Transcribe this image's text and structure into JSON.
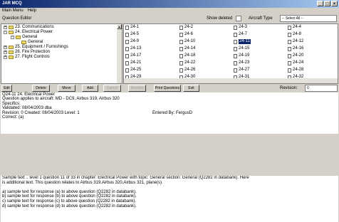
{
  "window": {
    "title": "JAR MCQ",
    "controls": [
      "_",
      "□",
      "×"
    ]
  },
  "menu": [
    "Main Menu",
    "Help"
  ],
  "toolbar": {
    "question_editor_label": "Question Editor",
    "show_deleted_label": "Show deleted",
    "aircraft_type_label": "Aircraft Type",
    "aircraft_type_value": "-- Select All --"
  },
  "tree": [
    {
      "expander": "+",
      "label": "23. Communications"
    },
    {
      "expander": "-",
      "label": "24. Electrical Power"
    },
    {
      "expander": "-",
      "label": "General"
    },
    {
      "expander": "",
      "label": "General"
    },
    {
      "expander": "+",
      "label": "25. Equipment / Furnishings"
    },
    {
      "expander": "+",
      "label": "26. Fire Protection"
    },
    {
      "expander": "+",
      "label": "27. Flight Controls"
    }
  ],
  "questions": [
    [
      "24-1",
      "24-2",
      "24-3",
      "24-4"
    ],
    [
      "24-5",
      "24-6",
      "24-7",
      "24-8"
    ],
    [
      "24-9",
      "24-10",
      "24-11",
      "24-12"
    ],
    [
      "24-13",
      "24-14",
      "24-15",
      "24-16"
    ],
    [
      "24-17",
      "24-18",
      "24-19",
      "24-20"
    ],
    [
      "24-21",
      "24-22",
      "24-23",
      "24-24"
    ],
    [
      "24-25",
      "24-26",
      "24-27",
      "24-28"
    ],
    [
      "24-29",
      "24-30",
      "24-31",
      "24-32"
    ]
  ],
  "selected_question": "24-11",
  "buttons": [
    "Edit",
    "Delete",
    "Move",
    "Add",
    "Cancel",
    "Reorder",
    "Print Questions",
    "Exit"
  ],
  "revision_label": "Revision:",
  "revision_value": "0",
  "info": {
    "line1": "Q24-11      24. Electrical Power",
    "line2": "Question applies to aircraft: MD - DC9, Airbus 319, Airbus 320",
    "line3": "Specifics:",
    "line4": "Validated: 08/04/2003 dba",
    "line5": "Revision: 0    Created: 08/04/2003  Level: 1",
    "entered_by": "Entered By: FergusD",
    "line6": "Correct: (a)"
  },
  "body": {
    "line1": "Sample text .. level 1 question 11 of 33 in chapter: Electrical Power with topic: General section: General (Q2282 in databank). Here",
    "line2": "is additional text. This question relates to Airbus 319,Airbus 320,Airbus 321, plane(s).",
    "line3": "",
    "line4": "a) sample text for response (a) to above question (Q2282 in databank).",
    "line5": "b) sample text for response (b) to above question (Q2282 in databank).",
    "line6": "c) sample text for response (c) to above question (Q2282 in databank).",
    "line7": "d) sample text for response (d) to above question (Q2282 in databank)."
  }
}
